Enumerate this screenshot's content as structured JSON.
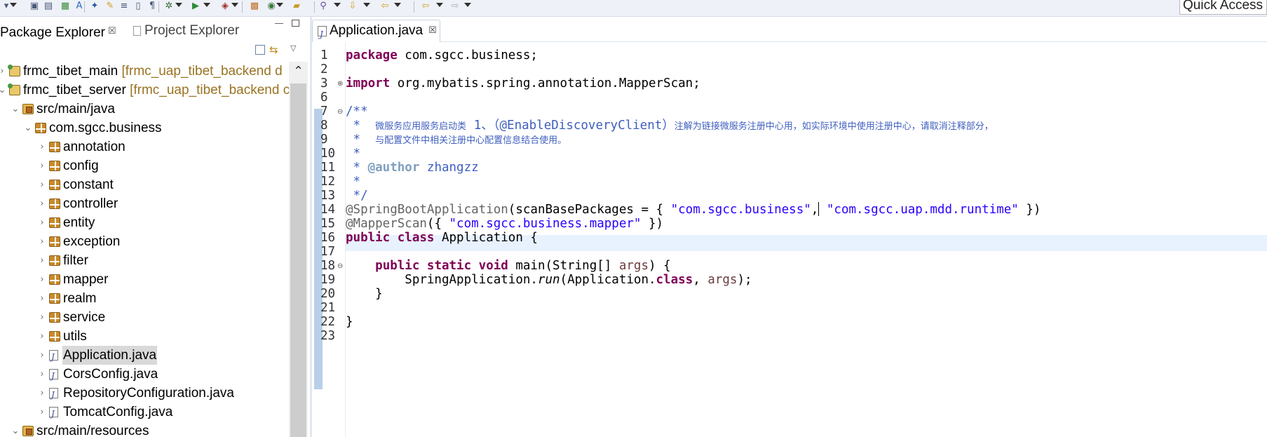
{
  "toolbar": {
    "quick_access": "Quick Access",
    "icons": [
      "menu-icon",
      "save-icon",
      "save-all-icon",
      "new-chart-icon",
      "text-icon",
      "pin-icon",
      "toggle-mark-icon",
      "format-icon",
      "task-icon",
      "paragraph-icon",
      "debug-icon",
      "run-icon",
      "coverage-icon",
      "new-class-icon",
      "open-type-icon",
      "open-folder-icon",
      "search-icon",
      "next-annotation-icon",
      "previous-annotation-icon",
      "back-icon",
      "forward-icon"
    ]
  },
  "left_view": {
    "tabs": [
      {
        "label": "Package Explorer",
        "close": "☒"
      },
      {
        "label": "Project Explorer"
      }
    ],
    "tree": [
      {
        "label": "frmc_tibet_main",
        "decoration": "[frmc_uap_tibet_backend d",
        "type": "project",
        "depth": 0,
        "twisty": "›"
      },
      {
        "label": "frmc_tibet_server",
        "decoration": "[frmc_uap_tibet_backend c",
        "type": "project",
        "depth": 0,
        "twisty": "⌄"
      },
      {
        "label": "src/main/java",
        "type": "srcfolder",
        "depth": 1,
        "twisty": "⌄"
      },
      {
        "label": "com.sgcc.business",
        "type": "package",
        "depth": 2,
        "twisty": "⌄"
      },
      {
        "label": "annotation",
        "type": "package",
        "depth": 3,
        "twisty": "›"
      },
      {
        "label": "config",
        "type": "package",
        "depth": 3,
        "twisty": "›"
      },
      {
        "label": "constant",
        "type": "package",
        "depth": 3,
        "twisty": "›"
      },
      {
        "label": "controller",
        "type": "package",
        "depth": 3,
        "twisty": "›"
      },
      {
        "label": "entity",
        "type": "package",
        "depth": 3,
        "twisty": "›"
      },
      {
        "label": "exception",
        "type": "package",
        "depth": 3,
        "twisty": "›"
      },
      {
        "label": "filter",
        "type": "package",
        "depth": 3,
        "twisty": "›"
      },
      {
        "label": "mapper",
        "type": "package",
        "depth": 3,
        "twisty": "›"
      },
      {
        "label": "realm",
        "type": "package",
        "depth": 3,
        "twisty": "›"
      },
      {
        "label": "service",
        "type": "package",
        "depth": 3,
        "twisty": "›"
      },
      {
        "label": "utils",
        "type": "package",
        "depth": 3,
        "twisty": "›"
      },
      {
        "label": "Application.java",
        "type": "java",
        "depth": 3,
        "twisty": "›",
        "selected": true
      },
      {
        "label": "CorsConfig.java",
        "type": "java",
        "depth": 3,
        "twisty": "›"
      },
      {
        "label": "RepositoryConfiguration.java",
        "type": "java",
        "depth": 3,
        "twisty": "›"
      },
      {
        "label": "TomcatConfig.java",
        "type": "java",
        "depth": 3,
        "twisty": "›"
      },
      {
        "label": "src/main/resources",
        "type": "srcfolder",
        "depth": 1,
        "twisty": "⌄"
      }
    ]
  },
  "editor": {
    "tab_label": "Application.java",
    "tab_close": "☒",
    "lines": [
      {
        "n": "1",
        "html": "<span class=\"kw\">package</span> com.sgcc.business;"
      },
      {
        "n": "2",
        "html": ""
      },
      {
        "n": "3",
        "fold": "⊕",
        "html": "<span class=\"kw\">import</span> org.mybatis.spring.annotation.MapperScan;"
      },
      {
        "n": "6",
        "html": ""
      },
      {
        "n": "7",
        "fold": "⊖",
        "html": "<span class=\"jd\">/**</span>"
      },
      {
        "n": "8",
        "html": "<span class=\"jd\"> *  <span class=\"cjk\">微服务应用服务启动类</span> 1、（@EnableDiscoveryClient）<span class=\"cjk\">注解为链接微服务注册中心用，如实际环境中使用注册中心，请取消注释部分，</span></span>"
      },
      {
        "n": "9",
        "html": "<span class=\"jd\"> *  <span class=\"cjk\">与配置文件中相关注册中心配置信息结合使用。</span></span>"
      },
      {
        "n": "10",
        "html": "<span class=\"jd\"> *</span>"
      },
      {
        "n": "11",
        "html": "<span class=\"jd\"> * <span class=\"jdtag\">@author</span> zhangzz</span>"
      },
      {
        "n": "12",
        "html": "<span class=\"jd\"> *</span>"
      },
      {
        "n": "13",
        "html": "<span class=\"jd\"> */</span>"
      },
      {
        "n": "14",
        "html": "<span class=\"ann\">@SpringBootApplication</span>(scanBasePackages = { <span class=\"str\">\"com.sgcc.business\"</span>,<span class=\"caret\"></span> <span class=\"str\">\"com.sgcc.uap.mdd.runtime\"</span> })"
      },
      {
        "n": "15",
        "html": "<span class=\"ann\">@MapperScan</span>({ <span class=\"str\">\"com.sgcc.business.mapper\"</span> })"
      },
      {
        "n": "16",
        "html": "<span class=\"kw\">public class</span> Application {"
      },
      {
        "n": "17",
        "html": ""
      },
      {
        "n": "18",
        "fold": "⊖",
        "html": "    <span class=\"kw\">public static void</span> main(String[] <span class=\"param\">args</span>) {"
      },
      {
        "n": "19",
        "html": "        SpringApplication.<span class=\"italic\">run</span>(Application.<span class=\"kw\">class</span>, <span class=\"param\">args</span>);"
      },
      {
        "n": "20",
        "html": "    }"
      },
      {
        "n": "21",
        "html": ""
      },
      {
        "n": "22",
        "html": "}"
      },
      {
        "n": "23",
        "html": ""
      }
    ]
  }
}
